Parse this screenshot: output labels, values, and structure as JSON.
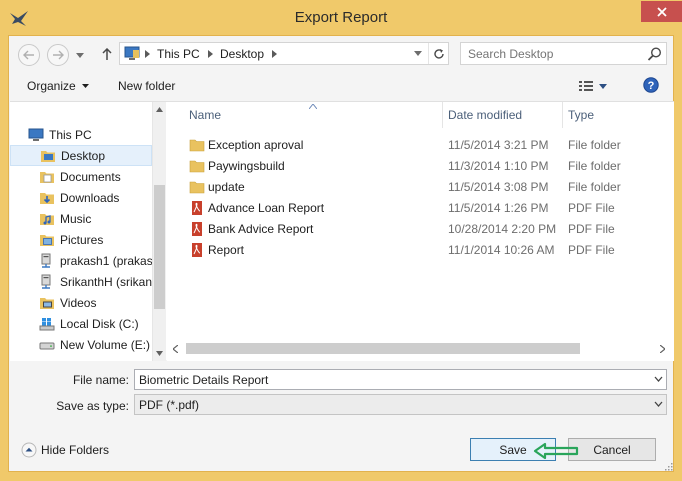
{
  "window": {
    "title": "Export Report"
  },
  "address": {
    "crumbs": [
      "This PC",
      "Desktop"
    ]
  },
  "search": {
    "placeholder": "Search Desktop"
  },
  "toolbar": {
    "organize": "Organize",
    "new_folder": "New folder"
  },
  "nav": {
    "items": [
      {
        "label": "This PC",
        "icon": "computer-icon"
      },
      {
        "label": "Desktop",
        "icon": "desktop-folder-icon",
        "selected": true
      },
      {
        "label": "Documents",
        "icon": "documents-icon"
      },
      {
        "label": "Downloads",
        "icon": "downloads-icon"
      },
      {
        "label": "Music",
        "icon": "music-icon"
      },
      {
        "label": "Pictures",
        "icon": "pictures-icon"
      },
      {
        "label": "prakash1 (prakas",
        "icon": "network-drive-icon"
      },
      {
        "label": "SrikanthH (srikan",
        "icon": "network-drive-icon"
      },
      {
        "label": "Videos",
        "icon": "videos-icon"
      },
      {
        "label": "Local Disk (C:)",
        "icon": "windows-drive-icon"
      },
      {
        "label": "New Volume (E:)",
        "icon": "drive-icon"
      }
    ]
  },
  "files": {
    "columns": {
      "name": "Name",
      "date": "Date modified",
      "type": "Type"
    },
    "rows": [
      {
        "name": "Exception aproval",
        "date": "11/5/2014 3:21 PM",
        "type": "File folder",
        "icon": "folder-icon"
      },
      {
        "name": "Paywingsbuild",
        "date": "11/3/2014 1:10 PM",
        "type": "File folder",
        "icon": "folder-icon"
      },
      {
        "name": "update",
        "date": "11/5/2014 3:08 PM",
        "type": "File folder",
        "icon": "folder-icon"
      },
      {
        "name": "Advance Loan Report",
        "date": "11/5/2014 1:26 PM",
        "type": "PDF File",
        "icon": "pdf-icon"
      },
      {
        "name": "Bank Advice Report",
        "date": "10/28/2014 2:20 PM",
        "type": "PDF File",
        "icon": "pdf-icon"
      },
      {
        "name": "Report",
        "date": "11/1/2014 10:26 AM",
        "type": "PDF File",
        "icon": "pdf-icon"
      }
    ]
  },
  "form": {
    "file_name_label": "File name:",
    "file_name_value": "Biometric Details Report",
    "save_type_label": "Save as type:",
    "save_type_value": "PDF (*.pdf)"
  },
  "footer": {
    "hide_folders": "Hide Folders",
    "save": "Save",
    "cancel": "Cancel"
  },
  "colors": {
    "frame": "#f0c96a",
    "close": "#c7504e",
    "accent": "#3c7fb1",
    "annotation": "#2aa55b"
  }
}
